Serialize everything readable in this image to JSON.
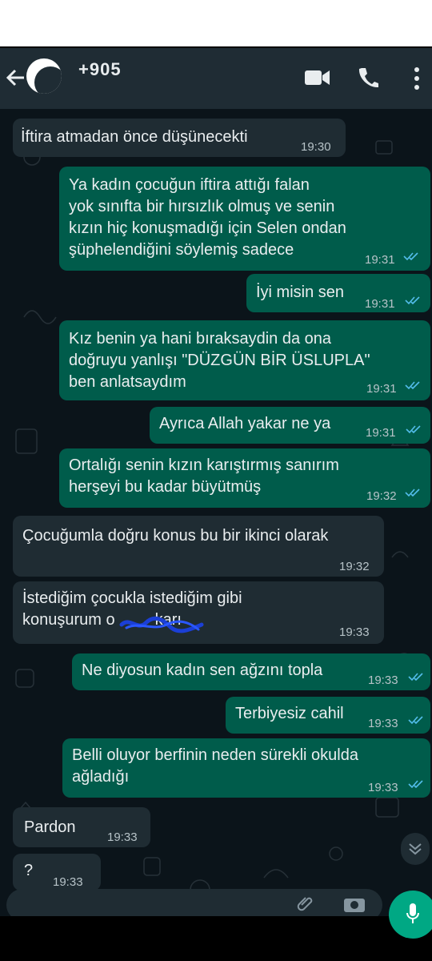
{
  "header": {
    "contact_name": "+905",
    "icons": [
      "back-arrow-icon",
      "video-call-icon",
      "phone-icon",
      "more-vert-icon"
    ]
  },
  "messages": [
    {
      "direction": "in",
      "lines": [
        "İftira atmadan önce düşünecekti"
      ],
      "time": "19:30"
    },
    {
      "direction": "out",
      "lines": [
        "Ya kadın çocuğun iftira attığı falan",
        "yok sınıfta bir hırsızlık olmuş ve senin",
        "kızın hiç konuşmadığı için Selen ondan",
        "şüphelendiğini söylemiş sadece"
      ],
      "time": "19:31",
      "status": "read"
    },
    {
      "direction": "out",
      "lines": [
        "İyi misin sen"
      ],
      "time": "19:31",
      "status": "read"
    },
    {
      "direction": "out",
      "lines": [
        "Kız benin ya hani bıraksaydin da ona",
        "doğruyu yanlışı \"DÜZGÜN BİR ÜSLUPLA\"",
        "ben anlatsaydım"
      ],
      "time": "19:31",
      "status": "read"
    },
    {
      "direction": "out",
      "lines": [
        "Ayrıca Allah yakar ne ya"
      ],
      "time": "19:31",
      "status": "read"
    },
    {
      "direction": "out",
      "lines": [
        "Ortalığı senin kızın karıştırmış sanırım",
        "herşeyi bu kadar büyütmüş"
      ],
      "time": "19:32",
      "status": "read"
    },
    {
      "direction": "in",
      "lines": [
        "Çocuğumla doğru konus bu bir ikinci olarak"
      ],
      "time": "19:32"
    },
    {
      "direction": "in",
      "lines": [
        "İstediğim çocukla istediğim gibi",
        "konuşurum o         karı"
      ],
      "time": "19:33"
    },
    {
      "direction": "out",
      "lines": [
        "Ne diyosun kadın sen ağzını topla"
      ],
      "time": "19:33",
      "status": "read"
    },
    {
      "direction": "out",
      "lines": [
        "Terbiyesiz cahil"
      ],
      "time": "19:33",
      "status": "read"
    },
    {
      "direction": "out",
      "lines": [
        "Belli oluyor berfinin neden sürekli okulda",
        "ağladığı"
      ],
      "time": "19:33",
      "status": "read"
    },
    {
      "direction": "in",
      "lines": [
        "Pardon"
      ],
      "time": "19:33"
    },
    {
      "direction": "in",
      "lines": [
        "?"
      ],
      "time": "19:33"
    }
  ],
  "colors": {
    "incoming": "#1f2c33",
    "outgoing": "#005c4b",
    "header": "#1f2c34",
    "read_ticks": "#53bdeb",
    "send": "#00a884"
  }
}
